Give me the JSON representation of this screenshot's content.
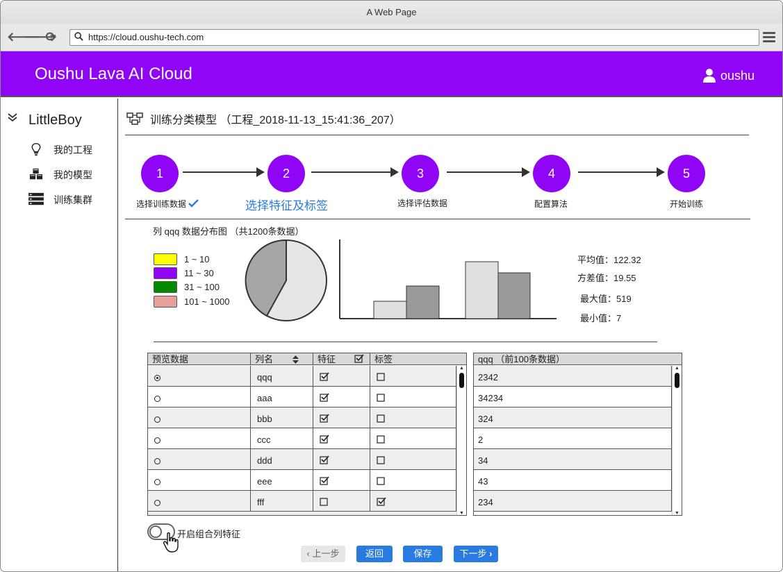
{
  "window": {
    "title": "A Web Page",
    "url": "https://cloud.oushu-tech.com"
  },
  "header": {
    "app_title": "Oushu Lava AI Cloud",
    "user": "oushu"
  },
  "sidebar": {
    "title": "LittleBoy",
    "items": [
      {
        "label": "我的工程",
        "icon": "lightbulb-icon"
      },
      {
        "label": "我的模型",
        "icon": "cubes-icon"
      },
      {
        "label": "训练集群",
        "icon": "server-icon"
      }
    ]
  },
  "page": {
    "title": "训练分类模型 （工程_2018-11-13_15:41:36_207）"
  },
  "steps": [
    {
      "num": "1",
      "label": "选择训练数据",
      "done": true
    },
    {
      "num": "2",
      "label": "选择特征及标签",
      "active": true
    },
    {
      "num": "3",
      "label": "选择评估数据"
    },
    {
      "num": "4",
      "label": "配置算法"
    },
    {
      "num": "5",
      "label": "开始训练"
    }
  ],
  "distribution": {
    "title": "列 qqq 数据分布图 （共1200条数据）",
    "legend": [
      {
        "label": "1 ~ 10",
        "color": "#ffff00"
      },
      {
        "label": "11 ~ 30",
        "color": "#9105f6"
      },
      {
        "label": "31 ~ 100",
        "color": "#008a00"
      },
      {
        "label": "101 ~ 1000",
        "color": "#e8a09a"
      }
    ],
    "stats": {
      "mean": "平均值：122.32",
      "variance": "方差值：19.55",
      "max": "最大值：519",
      "min": "最小值：7"
    }
  },
  "columns_table": {
    "headers": {
      "preview": "预览数据",
      "name": "列名",
      "feature": "特征",
      "label": "标签"
    },
    "rows": [
      {
        "name": "qqq",
        "selected": true,
        "feature": true,
        "label": false
      },
      {
        "name": "aaa",
        "selected": false,
        "feature": true,
        "label": false
      },
      {
        "name": "bbb",
        "selected": false,
        "feature": true,
        "label": false
      },
      {
        "name": "ccc",
        "selected": false,
        "feature": true,
        "label": false
      },
      {
        "name": "ddd",
        "selected": false,
        "feature": true,
        "label": false
      },
      {
        "name": "eee",
        "selected": false,
        "feature": true,
        "label": false
      },
      {
        "name": "fff",
        "selected": false,
        "feature": false,
        "label": true
      }
    ]
  },
  "preview_table": {
    "header": "qqq （前100条数据）",
    "values": [
      "2342",
      "34234",
      "324",
      "2",
      "34",
      "43",
      "234"
    ]
  },
  "combine_toggle": {
    "label": "开启组合列特征",
    "on": false
  },
  "buttons": {
    "prev": "上一步",
    "back": "返回",
    "save": "保存",
    "next": "下一步"
  }
}
